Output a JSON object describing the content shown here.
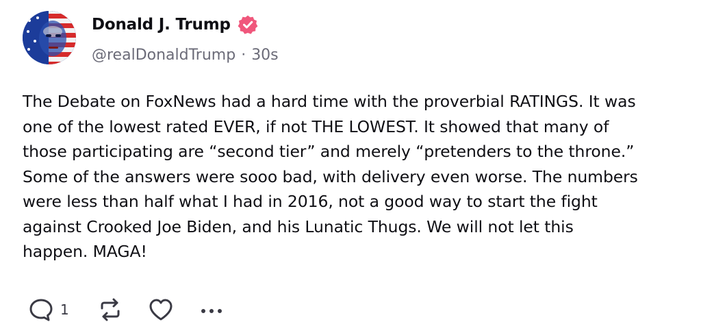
{
  "post": {
    "author": {
      "display_name": "Donald J. Trump",
      "handle": "@realDonaldTrump",
      "separator": "·",
      "time_ago": "30s",
      "verified": true
    },
    "text_lines": [
      "The Debate on FoxNews had a hard time with the proverbial RATINGS. It was",
      "one of the lowest rated EVER, if not THE LOWEST. It showed that many of",
      "those participating are “second tier” and merely “pretenders to the throne.”",
      "Some of the answers were sooo bad, with delivery even worse. The numbers",
      "were less than half what I had in 2016, not a good way to start the fight",
      "against Crooked Joe Biden, and his Lunatic Thugs. We will not let this",
      "happen. MAGA!"
    ],
    "actions": {
      "reply_count": "1"
    }
  },
  "icons": {
    "verified": "verified-badge-icon",
    "reply": "reply-bubble-icon",
    "repost": "repost-arrows-icon",
    "like": "heart-icon",
    "more": "more-dots-icon"
  },
  "colors": {
    "text": "#0f0f14",
    "muted": "#6b6b78",
    "verified_badge": "#f0577c",
    "icon": "#3a3a44"
  }
}
